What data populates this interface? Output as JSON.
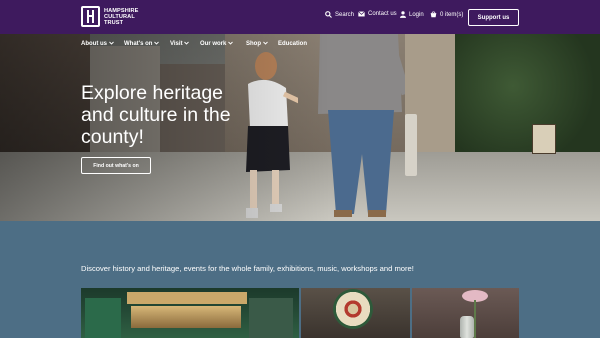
{
  "brand": {
    "logo_lines": [
      "HAMPSHIRE",
      "CULTURAL",
      "TRUST"
    ]
  },
  "utility_nav": {
    "search": "Search",
    "contact": "Contact us",
    "login": "Login",
    "basket": "0 item(s)",
    "support": "Support us"
  },
  "main_nav": {
    "items": [
      {
        "label": "About us",
        "has_dropdown": true
      },
      {
        "label": "What's on",
        "has_dropdown": true
      },
      {
        "label": "Visit",
        "has_dropdown": true
      },
      {
        "label": "Our work",
        "has_dropdown": true
      },
      {
        "label": "Shop",
        "has_dropdown": true
      },
      {
        "label": "Education",
        "has_dropdown": false
      }
    ]
  },
  "hero": {
    "title": "Explore heritage and culture in the county!",
    "cta": "Find out what's on"
  },
  "intro": {
    "text": "Discover history and heritage, events for the whole family, exhibitions, music, workshops and more!"
  },
  "colors": {
    "topbar": "#3e1a5e",
    "body": "#4d6e85",
    "text": "#ffffff"
  },
  "icons": [
    "search-icon",
    "envelope-icon",
    "user-icon",
    "basket-icon",
    "chevron-down-icon"
  ]
}
